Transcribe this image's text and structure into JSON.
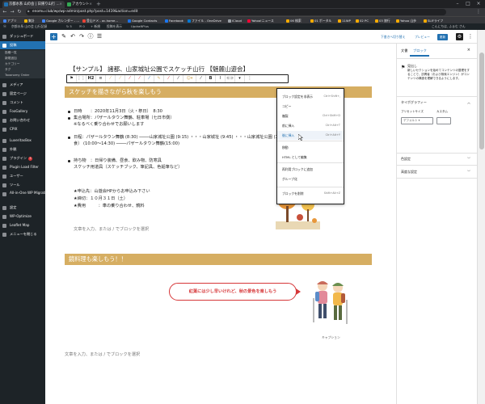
{
  "browser": {
    "tabs": [
      {
        "title": "京都水系 山の会 | 日帰り山行 ...",
        "active": true
      },
      {
        "title": "アカウント"
      }
    ],
    "url": "enomu.club/wp/wp-admin/post.php?post=1419&action=edit",
    "bookmarks": [
      {
        "label": "アプリ",
        "color": "#4285f4"
      },
      {
        "label": "集計",
        "color": "#fbbc04"
      },
      {
        "label": "Google カレンダー - ...",
        "color": "#4285f4"
      },
      {
        "label": "登山ドメ - ac.home...",
        "color": "#ea4335"
      },
      {
        "label": "Google Contacts",
        "color": "#1a73e8"
      },
      {
        "label": "Facebook",
        "color": "#1877f2"
      },
      {
        "label": "ファイル - OneDrive",
        "color": "#0078d4"
      },
      {
        "label": "iCloud",
        "color": "#9aa0a6"
      },
      {
        "label": "Yahoo!ニュース",
        "color": "#ff0033"
      },
      {
        "label": "06 検索",
        "color": "#f9ab00"
      },
      {
        "label": "01 ポータル",
        "color": "#f9ab00"
      },
      {
        "label": "11WP",
        "color": "#f9ab00"
      },
      {
        "label": "02 PC",
        "color": "#f9ab00"
      },
      {
        "label": "03 旅行",
        "color": "#f9ab00"
      },
      {
        "label": "Yahoo 山歩",
        "color": "#f9ab00"
      },
      {
        "label": "SLIFライフ",
        "color": "#f9ab00"
      }
    ]
  },
  "adminbar": {
    "items": [
      "京都水系 山の会 山行記録",
      "5",
      "0",
      "+ 新規",
      "投稿を表示",
      "UpdraftPlus"
    ],
    "greeting": "こんにちは, ふぁむ さん"
  },
  "sidebar": {
    "items": [
      {
        "label": "ダッシュボード",
        "type": "main"
      },
      {
        "label": "投稿",
        "type": "active"
      },
      {
        "label": "投稿一覧",
        "type": "sub"
      },
      {
        "label": "新規追加",
        "type": "sub"
      },
      {
        "label": "カテゴリー",
        "type": "sub"
      },
      {
        "label": "タグ",
        "type": "sub"
      },
      {
        "label": "Taxonomy Order",
        "type": "sub"
      },
      {
        "label": "メディア",
        "type": "main"
      },
      {
        "label": "固定ページ",
        "type": "main"
      },
      {
        "label": "コメント",
        "type": "main"
      },
      {
        "label": "FooGallery",
        "type": "main"
      },
      {
        "label": "お問い合わせ",
        "type": "main"
      },
      {
        "label": "CPIX",
        "type": "main"
      },
      {
        "label": "LuxeritasBox",
        "type": "main"
      },
      {
        "label": "外観",
        "type": "main"
      },
      {
        "label": "プラグイン",
        "type": "main",
        "badge": "5"
      },
      {
        "label": "Plugin Load Filter",
        "type": "main"
      },
      {
        "label": "ユーザー",
        "type": "main"
      },
      {
        "label": "ツール",
        "type": "main"
      },
      {
        "label": "All-in-One WP Migration",
        "type": "two"
      },
      {
        "label": "設定",
        "type": "main"
      },
      {
        "label": "WP-Optimize",
        "type": "main"
      },
      {
        "label": "Leaflet Map",
        "type": "main"
      },
      {
        "label": "メニューを閉じる",
        "type": "main"
      }
    ]
  },
  "editor_top": {
    "save_draft": "下書きへ切り替え",
    "preview": "プレビュー",
    "publish": "更新"
  },
  "post": {
    "title": "【サンプル】 諸都、山家城址公園でスケッチ山行 【魅麓山遊会】",
    "heading1": "スケッチを描きながら秋を楽しもう",
    "lines": [
      {
        "text": "日時　　：2020年11月3日（火・祭日）　8:30",
        "bullet": true
      },
      {
        "text": "集合場所：パザールタウン舞鶴、駐車場（七日市側）",
        "bullet": true
      },
      {
        "text": "※なるべく乗り合わせでお願いします",
        "bullet": false
      },
      {
        "text": "日程：パザールタウン舞鶴 (8:30) ────山家城址公園 (9:15) ・・・山家城址 (9:45) ・・・山家城址公園 (10:00) スケッチ、昼",
        "bullet": true
      },
      {
        "text": "食） (10:00〜14:30) ────パザールタウン舞鶴(15:00)",
        "bullet": false
      },
      {
        "text": "持ち物　：日帰り装備、昼食、飲み物、防寒具",
        "bullet": true
      },
      {
        "text": "スケッチ用道具（スケッチブック、筆記具、色鉛筆など）",
        "bullet": false
      },
      {
        "text": "★申込先：山遊会HPからお申込み下さい",
        "bullet": false
      },
      {
        "text": "★締切：１０月３１日（土）",
        "bullet": false
      },
      {
        "text": "★費用　　　：車の乗り合わせ、鏡料",
        "bullet": false
      }
    ],
    "placeholder": "文章を入力、または / でブロックを選択",
    "heading2": "鏡料理も楽しもう！！",
    "bubble": "紅葉には少し早いけれど、秋の景色を楽しもう",
    "caption": "キャプション"
  },
  "block_menu": {
    "items": [
      {
        "label": "ブロック設定を非表示",
        "shortcut": "Ctrl+Shift+,"
      },
      {
        "label": "コピー",
        "shortcut": ""
      },
      {
        "label": "複製",
        "shortcut": "Ctrl+Shift+D"
      },
      {
        "label": "前に挿入",
        "shortcut": "Ctrl+Alt+T"
      },
      {
        "label": "後に挿入",
        "shortcut": "Ctrl+Alt+Y"
      },
      {
        "label": "移動",
        "shortcut": ""
      },
      {
        "label": "HTML として編集",
        "shortcut": ""
      },
      {
        "label": "再利用ブロックに追加",
        "shortcut": ""
      },
      {
        "label": "グループ化",
        "shortcut": ""
      },
      {
        "label": "ブロックを削除",
        "shortcut": "Shift+Alt+Z"
      }
    ],
    "highlighted_index": 4
  },
  "panel": {
    "tabs": [
      "文書",
      "ブロック"
    ],
    "block_name": "見出し",
    "block_desc": "新しいセクションを始めてコンテンツの整理をすることで、訪問者（および検索エンジン）がコンテンツの構造を理解できるようにします。",
    "typography": "タイポグラフィー",
    "preset_label": "プリセットサイズ",
    "custom_label": "カスタム",
    "preset_value": "デフォルト",
    "section_color": "色設定",
    "section_advanced": "高度な設定"
  },
  "colors": {
    "heading_bar": "#d6ae62",
    "accent": "#2271b1",
    "bubble": "#d63638"
  }
}
